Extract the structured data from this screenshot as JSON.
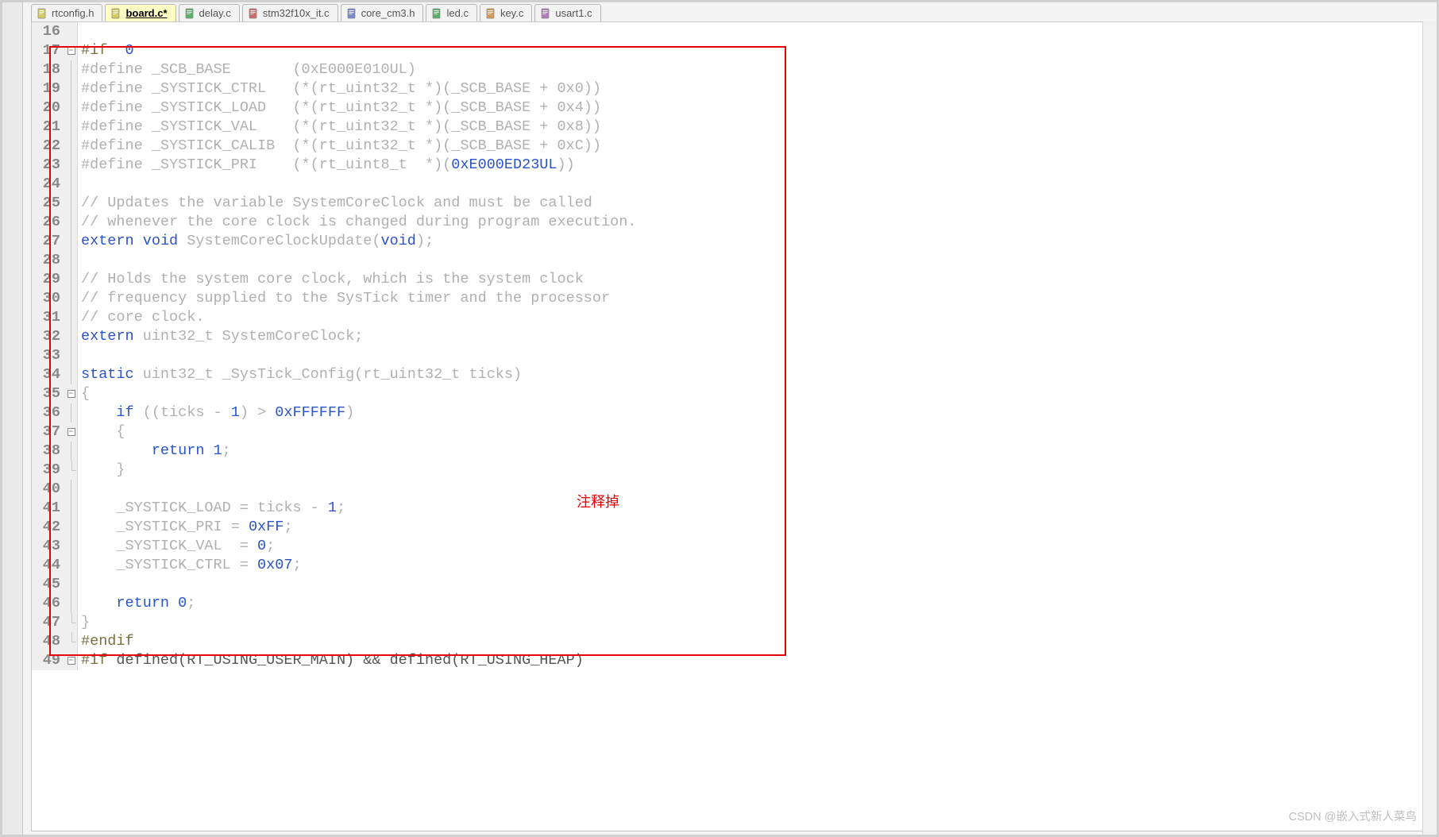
{
  "tabs": [
    {
      "label": "rtconfig.h",
      "icon_color": "#d6c863",
      "active": false
    },
    {
      "label": "board.c*",
      "icon_color": "#d6c863",
      "active": true
    },
    {
      "label": "delay.c",
      "icon_color": "#5ab06a",
      "active": false
    },
    {
      "label": "stm32f10x_it.c",
      "icon_color": "#d06a6a",
      "active": false
    },
    {
      "label": "core_cm3.h",
      "icon_color": "#7a8ad0",
      "active": false
    },
    {
      "label": "led.c",
      "icon_color": "#5ab06a",
      "active": false
    },
    {
      "label": "key.c",
      "icon_color": "#d89a5a",
      "active": false
    },
    {
      "label": "usart1.c",
      "icon_color": "#b07ab8",
      "active": false
    }
  ],
  "annotation": "注释掉",
  "watermark": "CSDN @嵌入式新人菜鸟",
  "code_lines": [
    {
      "num": 16,
      "fold": "",
      "tokens": []
    },
    {
      "num": 17,
      "fold": "minus",
      "tokens": [
        [
          "pp",
          "#if"
        ],
        [
          "dim",
          "  "
        ],
        [
          "num",
          "0"
        ]
      ]
    },
    {
      "num": 18,
      "fold": "|",
      "tokens": [
        [
          "dim",
          "#define _SCB_BASE       (0xE000E010UL)"
        ]
      ]
    },
    {
      "num": 19,
      "fold": "|",
      "tokens": [
        [
          "dim",
          "#define _SYSTICK_CTRL   (*(rt_uint32_t *)(_SCB_BASE + 0x0))"
        ]
      ]
    },
    {
      "num": 20,
      "fold": "|",
      "tokens": [
        [
          "dim",
          "#define _SYSTICK_LOAD   (*(rt_uint32_t *)(_SCB_BASE + 0x4))"
        ]
      ]
    },
    {
      "num": 21,
      "fold": "|",
      "tokens": [
        [
          "dim",
          "#define _SYSTICK_VAL    (*(rt_uint32_t *)(_SCB_BASE + 0x8))"
        ]
      ]
    },
    {
      "num": 22,
      "fold": "|",
      "tokens": [
        [
          "dim",
          "#define _SYSTICK_CALIB  (*(rt_uint32_t *)(_SCB_BASE + 0xC))"
        ]
      ]
    },
    {
      "num": 23,
      "fold": "|",
      "tokens": [
        [
          "dim",
          "#define _SYSTICK_PRI    (*(rt_uint8_t  *)("
        ],
        [
          "num",
          "0xE000ED23UL"
        ],
        [
          "dim",
          "))"
        ]
      ]
    },
    {
      "num": 24,
      "fold": "|",
      "tokens": []
    },
    {
      "num": 25,
      "fold": "|",
      "tokens": [
        [
          "dim",
          "// Updates the variable SystemCoreClock and must be called"
        ]
      ]
    },
    {
      "num": 26,
      "fold": "|",
      "tokens": [
        [
          "dim",
          "// whenever the core clock is changed during program execution."
        ]
      ]
    },
    {
      "num": 27,
      "fold": "|",
      "tokens": [
        [
          "kw",
          "extern"
        ],
        [
          "dim",
          " "
        ],
        [
          "kw",
          "void"
        ],
        [
          "dim",
          " SystemCoreClockUpdate("
        ],
        [
          "kw",
          "void"
        ],
        [
          "dim",
          ");"
        ]
      ]
    },
    {
      "num": 28,
      "fold": "|",
      "tokens": []
    },
    {
      "num": 29,
      "fold": "|",
      "tokens": [
        [
          "dim",
          "// Holds the system core clock, which is the system clock"
        ]
      ]
    },
    {
      "num": 30,
      "fold": "|",
      "tokens": [
        [
          "dim",
          "// frequency supplied to the SysTick timer and the processor"
        ]
      ]
    },
    {
      "num": 31,
      "fold": "|",
      "tokens": [
        [
          "dim",
          "// core clock."
        ]
      ]
    },
    {
      "num": 32,
      "fold": "|",
      "tokens": [
        [
          "kw",
          "extern"
        ],
        [
          "dim",
          " uint32_t SystemCoreClock;"
        ]
      ]
    },
    {
      "num": 33,
      "fold": "|",
      "tokens": []
    },
    {
      "num": 34,
      "fold": "|",
      "tokens": [
        [
          "kw",
          "static"
        ],
        [
          "dim",
          " uint32_t _SysTick_Config(rt_uint32_t ticks)"
        ]
      ]
    },
    {
      "num": 35,
      "fold": "minus",
      "tokens": [
        [
          "dim",
          "{"
        ]
      ]
    },
    {
      "num": 36,
      "fold": "|",
      "tokens": [
        [
          "dim",
          "    "
        ],
        [
          "kw",
          "if"
        ],
        [
          "dim",
          " ((ticks - "
        ],
        [
          "num",
          "1"
        ],
        [
          "dim",
          ") > "
        ],
        [
          "num",
          "0xFFFFFF"
        ],
        [
          "dim",
          ")"
        ]
      ]
    },
    {
      "num": 37,
      "fold": "minus",
      "tokens": [
        [
          "dim",
          "    {"
        ]
      ]
    },
    {
      "num": 38,
      "fold": "|",
      "tokens": [
        [
          "dim",
          "        "
        ],
        [
          "kw",
          "return"
        ],
        [
          "dim",
          " "
        ],
        [
          "num",
          "1"
        ],
        [
          "dim",
          ";"
        ]
      ]
    },
    {
      "num": 39,
      "fold": "end",
      "tokens": [
        [
          "dim",
          "    }"
        ]
      ]
    },
    {
      "num": 40,
      "fold": "|",
      "tokens": []
    },
    {
      "num": 41,
      "fold": "|",
      "tokens": [
        [
          "dim",
          "    _SYSTICK_LOAD = ticks - "
        ],
        [
          "num",
          "1"
        ],
        [
          "dim",
          ";"
        ]
      ]
    },
    {
      "num": 42,
      "fold": "|",
      "tokens": [
        [
          "dim",
          "    _SYSTICK_PRI = "
        ],
        [
          "num",
          "0xFF"
        ],
        [
          "dim",
          ";"
        ]
      ]
    },
    {
      "num": 43,
      "fold": "|",
      "tokens": [
        [
          "dim",
          "    _SYSTICK_VAL  = "
        ],
        [
          "num",
          "0"
        ],
        [
          "dim",
          ";"
        ]
      ]
    },
    {
      "num": 44,
      "fold": "|",
      "tokens": [
        [
          "dim",
          "    _SYSTICK_CTRL = "
        ],
        [
          "num",
          "0x07"
        ],
        [
          "dim",
          ";"
        ]
      ]
    },
    {
      "num": 45,
      "fold": "|",
      "tokens": []
    },
    {
      "num": 46,
      "fold": "|",
      "tokens": [
        [
          "dim",
          "    "
        ],
        [
          "kw",
          "return"
        ],
        [
          "dim",
          " "
        ],
        [
          "num",
          "0"
        ],
        [
          "dim",
          ";"
        ]
      ]
    },
    {
      "num": 47,
      "fold": "end",
      "tokens": [
        [
          "dim",
          "}"
        ]
      ]
    },
    {
      "num": 48,
      "fold": "end",
      "tokens": [
        [
          "pp",
          "#endif"
        ]
      ]
    },
    {
      "num": 49,
      "fold": "minus",
      "tokens": [
        [
          "pp",
          "#if"
        ],
        [
          "txt",
          " defined(RT_USING_USER_MAIN) && defined(RT_USING_HEAP)"
        ]
      ]
    }
  ]
}
